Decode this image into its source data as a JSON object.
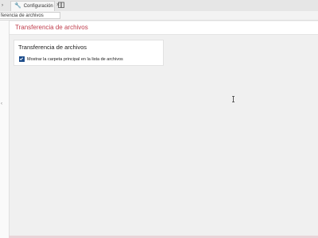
{
  "tabs": {
    "prev_label": "›",
    "config_label": "Configuración",
    "config_icon": "wrench-icon",
    "close_label": "×",
    "new_icon": "book-icon"
  },
  "path": {
    "value": "ferencia de archivos"
  },
  "header": {
    "title": "Transferencia de archivos",
    "accent": "#c0404f"
  },
  "panel": {
    "title": "Transferencia de archivos",
    "option_label": "Mostrar la carpeta principal en la lista de archivos",
    "option_checked": true,
    "checkbox_color": "#1f4e8c"
  }
}
